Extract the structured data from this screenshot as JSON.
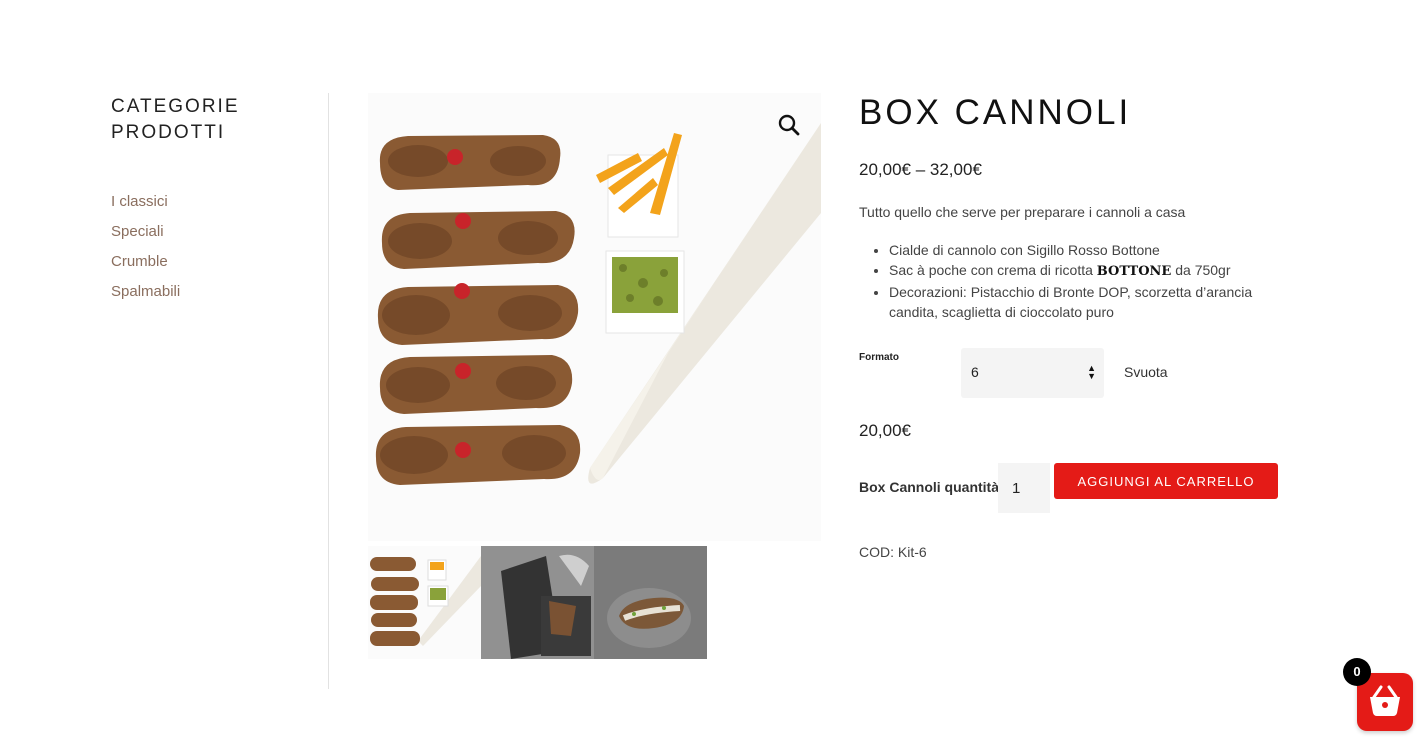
{
  "sidebar": {
    "title": "CATEGORIE\nPRODOTTI",
    "categories": [
      "I classici",
      "Speciali",
      "Crumble",
      "Spalmabili"
    ]
  },
  "gallery": {
    "zoom_icon": "magnifier-icon",
    "thumbnail_count": 3
  },
  "product": {
    "title": "BOX CANNOLI",
    "price_range": "20,00€ – 32,00€",
    "short_description": "Tutto quello che serve per preparare i cannoli a casa",
    "features": {
      "f1": "Cialde di cannolo con Sigillo Rosso Bottone",
      "f2_pre": "Sac à poche con crema di ricotta ",
      "f2_brand": "BOTTONE",
      "f2_post": " da 750gr",
      "f3": "Decorazioni: Pistacchio di Bronte DOP, scorzetta d’arancia candita, scaglietta di cioccolato puro"
    },
    "variation": {
      "label": "Formato",
      "selected": "6",
      "reset_label": "Svuota"
    },
    "variation_price": "20,00€",
    "quantity_label": "Box Cannoli quantità",
    "quantity": "1",
    "add_to_cart_label": "AGGIUNGI AL CARRELLO",
    "sku": "COD: Kit-6"
  },
  "cart": {
    "count": "0",
    "icon": "basket-icon"
  },
  "colors": {
    "accent": "#e41b17",
    "category_link": "#8a6e5e"
  }
}
